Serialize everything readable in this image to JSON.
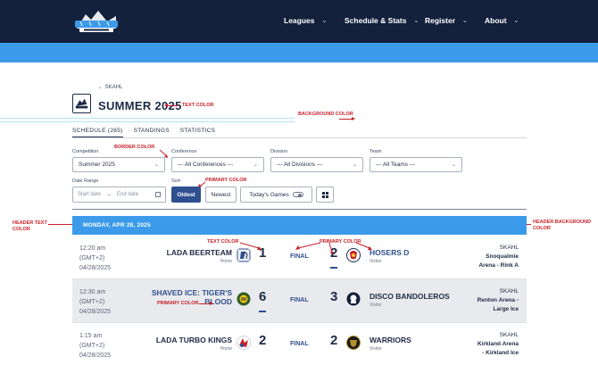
{
  "nav": {
    "items": [
      {
        "label": "Leagues",
        "chev": "⌄"
      },
      {
        "label": "Schedule & Stats",
        "chev": "⌄"
      },
      {
        "label": "Register",
        "chev": "⌄"
      },
      {
        "label": "About",
        "chev": "⌄"
      }
    ]
  },
  "header": {
    "back_label": "← SKAHL",
    "title": "SUMMER 2025"
  },
  "annotations": {
    "text_color_1": "TEXT COLOR",
    "background_color": "BACKGROUND COLOR",
    "border_color": "BORDER COLOR",
    "primary_color_1": "PRIMARY COLOR",
    "header_text_color_l1": "HEADER TEXT",
    "header_text_color_l2": "COLOR",
    "header_bg_color_l1": "HEADER BACKGROUND",
    "header_bg_color_l2": "COLOR",
    "text_color_2": "TEXT COLOR",
    "primary_color_2": "PRIMARY COLOR",
    "primary_color_3": "PRIMARY COLOR"
  },
  "tabs": [
    {
      "label": "SCHEDULE (265)",
      "active": true
    },
    {
      "label": "STANDINGS",
      "active": false
    },
    {
      "label": "STATISTICS",
      "active": false
    }
  ],
  "filters": {
    "competition": {
      "label": "Competition",
      "value": "Summer 2025"
    },
    "conference": {
      "label": "Conference",
      "value": "--- All Conferences ---"
    },
    "division": {
      "label": "Division",
      "value": "--- All Divisions ---"
    },
    "team": {
      "label": "Team",
      "value": "--- All Teams ---"
    },
    "date_range": {
      "label": "Date Range",
      "start_placeholder": "Start date",
      "arrow": "→",
      "end_placeholder": "End date"
    },
    "sort": {
      "label": "Sort"
    }
  },
  "buttons": {
    "oldest": "Oldest",
    "newest": "Newest",
    "todays_games": "Today's Games"
  },
  "schedule": {
    "date_header": "MONDAY, APR 28, 2025",
    "games": [
      {
        "time": "12:20 am",
        "tz": "(GMT+2)",
        "date": "04/28/2025",
        "home": "LADA BEERTEAM",
        "home_sub": "Home",
        "home_score": "1",
        "status": "FINAL",
        "away": "HOSERS D",
        "away_sub": "Visitor",
        "away_score": "2",
        "league": "SKAHL",
        "venue_l1": "Snoqualmie",
        "venue_l2": "Arena - Rink A"
      },
      {
        "time": "12:30 am",
        "tz": "(GMT+2)",
        "date": "04/28/2025",
        "home_l1": "SHAVED ICE: TIGER'S",
        "home_l2": "BLOOD",
        "home_score": "6",
        "status": "FINAL",
        "away": "DISCO BANDOLEROS",
        "away_sub": "Visitor",
        "away_score": "3",
        "league": "SKAHL",
        "venue_l1": "Renton Arena -",
        "venue_l2": "Large Ice"
      },
      {
        "time": "1:15 am",
        "tz": "(GMT+2)",
        "date": "04/28/2025",
        "home": "LADA TURBO KINGS",
        "home_sub": "Home",
        "home_score": "2",
        "status": "FINAL",
        "away": "WARRIORS",
        "away_sub": "Visitor",
        "away_score": "2",
        "league": "SKAHL",
        "venue_l1": "Kirkland Arena",
        "venue_l2": "- Kirkland Ice"
      }
    ]
  },
  "colors": {
    "nav_bg": "#14213d",
    "header_bg": "#3b9bea",
    "primary": "#2f4f8f",
    "annotation": "#c8202a"
  }
}
